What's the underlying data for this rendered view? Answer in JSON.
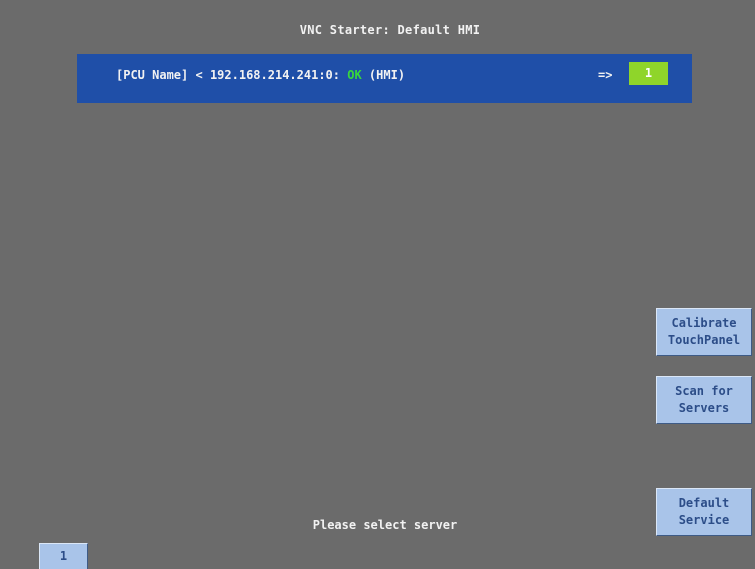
{
  "header": {
    "title": "VNC Starter: Default HMI"
  },
  "server_list": [
    {
      "name": "[PCU Name]",
      "separator": "<",
      "address": "192.168.214.241:0:",
      "status": "OK",
      "type": "(HMI)",
      "arrow": "=>",
      "slot": "1"
    }
  ],
  "side_buttons": {
    "calibrate": "Calibrate\nTouchPanel",
    "scan": "Scan for\nServers",
    "default_service": "Default\nService"
  },
  "status_text": "Please select server",
  "page_tab": "1",
  "colors": {
    "background": "#6b6b6b",
    "server_row": "#1f4fa8",
    "ok": "#39d63c",
    "slot": "#8fd52a",
    "button": "#a9c4e9",
    "button_text": "#2c4d88"
  }
}
